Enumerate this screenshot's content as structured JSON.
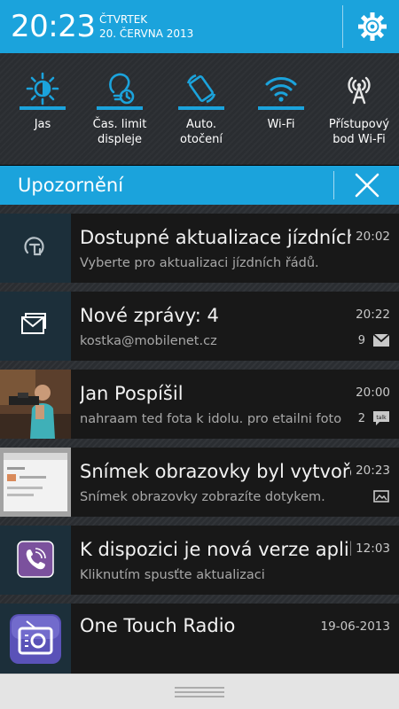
{
  "header": {
    "time": "20:23",
    "day": "ČTVRTEK",
    "date": "20. ČERVNA 2013",
    "settings_icon": "gear-icon"
  },
  "quick_settings": [
    {
      "label": "Jas",
      "icon": "brightness-icon"
    },
    {
      "label": "Čas. limit\ndispleje",
      "icon": "screen-timeout-icon"
    },
    {
      "label": "Auto.\notočení",
      "icon": "auto-rotate-icon"
    },
    {
      "label": "Wi-Fi",
      "icon": "wifi-icon"
    },
    {
      "label": "Přístupový\nbod Wi-Fi",
      "icon": "hotspot-icon"
    }
  ],
  "notifications_header": {
    "title": "Upozornění",
    "clear_icon": "close-icon"
  },
  "notifications": [
    {
      "title": "Dostupné aktualizace jízdních řádů",
      "text": "Vyberte pro aktualizaci jízdních řádů.",
      "time": "20:02",
      "icon": "timetable-update-icon"
    },
    {
      "title": "Nové zprávy: 4",
      "text": "kostka@mobilenet.cz",
      "time": "20:22",
      "count": "9",
      "small_icon": "mail-icon",
      "icon": "mail-stack-icon"
    },
    {
      "title": "Jan Pospíšil",
      "text": "nahraam ted fota k idolu. pro etailni foto",
      "time": "20:00",
      "count": "2",
      "small_icon": "talk-icon",
      "icon": "contact-photo"
    },
    {
      "title": "Snímek obrazovky byl vytvořen",
      "text": "Snímek obrazovky zobrazíte dotykem.",
      "time": "20:23",
      "small_icon": "image-icon",
      "icon": "screenshot-thumbnail"
    },
    {
      "title": "K dispozici je nová verze aplikace",
      "text": "Kliknutím spusťte aktualizaci",
      "time": "12:03",
      "icon": "viber-icon"
    },
    {
      "title": "One Touch Radio",
      "text": "",
      "time": "19-06-2013",
      "icon": "radio-icon"
    }
  ],
  "colors": {
    "accent": "#1ba3dc",
    "panel": "#2a2d31",
    "row": "#181818"
  }
}
